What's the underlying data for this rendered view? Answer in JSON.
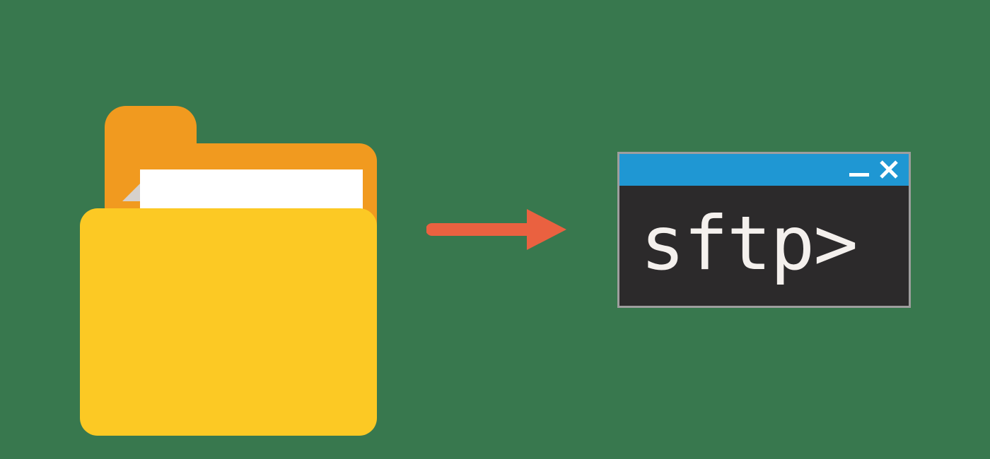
{
  "terminal": {
    "prompt": "sftp>"
  },
  "icons": {
    "folder": "folder-icon",
    "arrow": "arrow-right-icon",
    "minimize": "minimize-icon",
    "close": "close-icon"
  }
}
